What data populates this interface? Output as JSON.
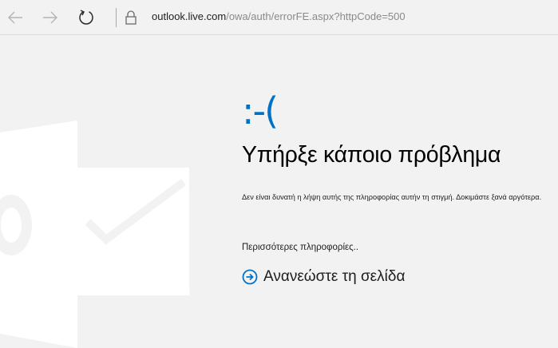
{
  "browser": {
    "url_domain": "outlook.live.com",
    "url_prefix": "",
    "url_path": "/owa/auth/errorFE.aspx?httpCode=500",
    "icons": {
      "back": "back-arrow-icon",
      "forward": "forward-arrow-icon",
      "refresh": "refresh-icon",
      "lock": "lock-icon"
    }
  },
  "error": {
    "emoticon": ":-(",
    "title": "Υπήρξε κάποιο πρόβλημα",
    "message": "Δεν είναι δυνατή η λήψη αυτής της πληροφορίας αυτήν τη στιγμή. Δοκιμάστε ξανά αργότερα.",
    "more_info": "Περισσότερες πληροφορίες..",
    "refresh_label": "Ανανεώστε τη σελίδα"
  },
  "colors": {
    "accent": "#0072c6",
    "background": "#f2f2f2",
    "logo": "#ffffff"
  }
}
